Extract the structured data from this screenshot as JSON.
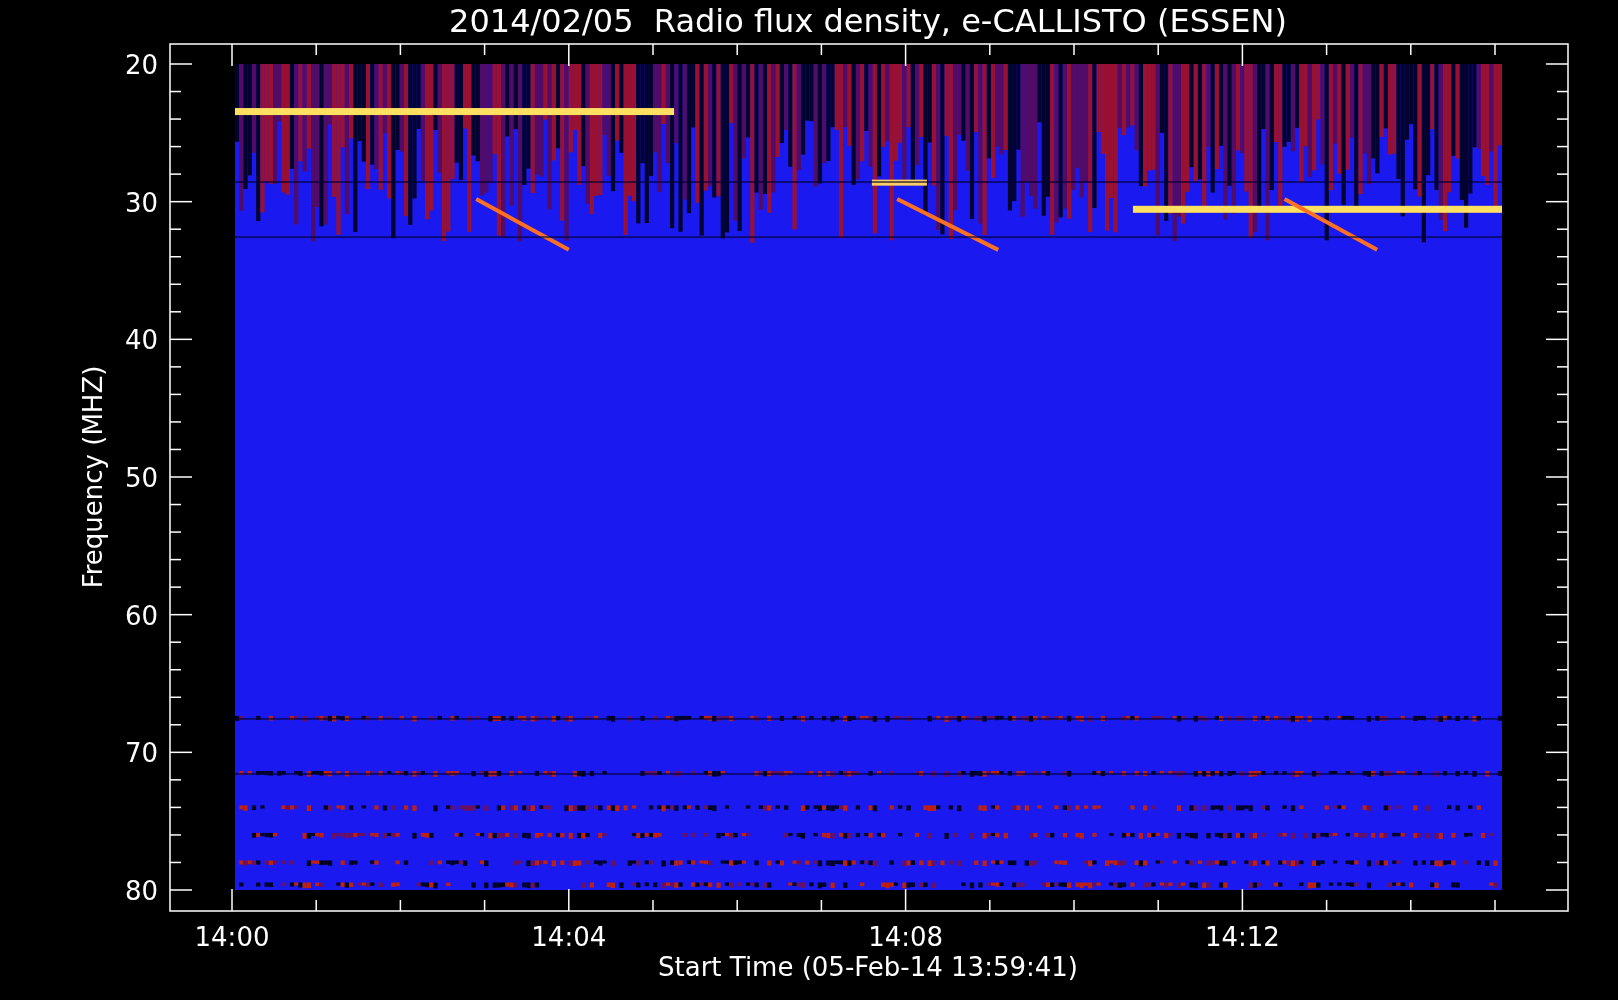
{
  "title": "2014/02/05  Radio flux density, e-CALLISTO (ESSEN)",
  "y_axis": {
    "label": "Frequency (MHZ)",
    "ticks": [
      "20",
      "30",
      "40",
      "50",
      "60",
      "70",
      "80"
    ]
  },
  "x_axis": {
    "label": "Start Time (05-Feb-14 13:59:41)",
    "ticks": [
      "14:00",
      "14:04",
      "14:08",
      "14:12"
    ]
  }
}
